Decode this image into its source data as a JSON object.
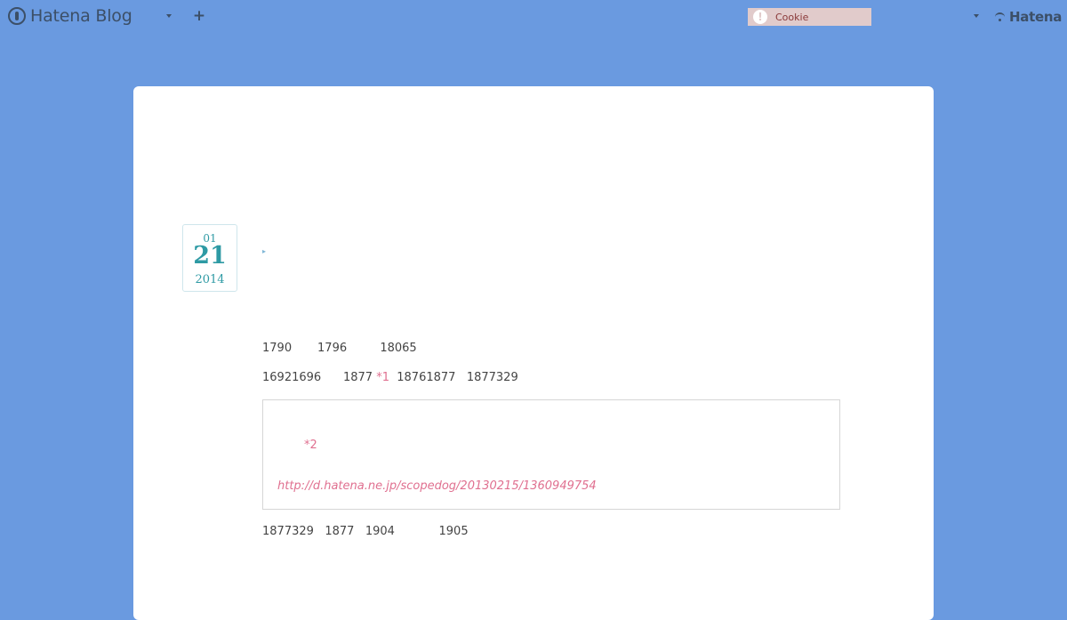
{
  "topbar": {
    "brand": "Hatena Blog",
    "cookie_notice": "Cookie",
    "cookie_alert_glyph": "!",
    "plus_glyph": "+",
    "hatena_logo": "Hatena"
  },
  "entry": {
    "date": {
      "month": "01",
      "day": "21",
      "year": "2014"
    },
    "title_marker": "▸",
    "paragraphs": {
      "p1": {
        "a": "1790",
        "b": "1796",
        "c": "18065"
      },
      "p2": {
        "a": "16921696",
        "b": "1877",
        "footnote": "*1",
        "c": "18761877",
        "d": "1877329"
      },
      "p3": {
        "a": "1877329",
        "b": "1877",
        "c": "1904",
        "d": "1905"
      }
    },
    "quote": {
      "footnote": "*2",
      "link": "http://d.hatena.ne.jp/scopedog/20130215/1360949754"
    }
  }
}
